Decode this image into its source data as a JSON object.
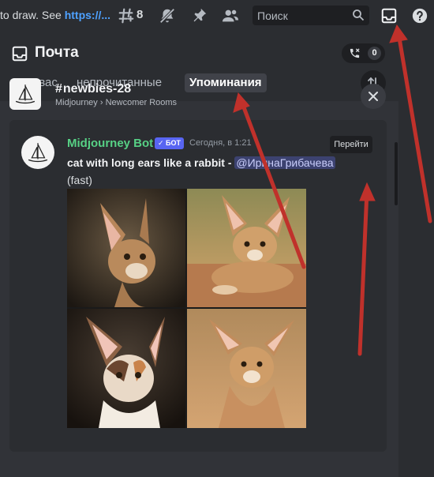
{
  "topbar": {
    "topic_text": "to draw. See ",
    "topic_link": "https://...",
    "threads_count": "8",
    "search_placeholder": "Поиск",
    "icons": [
      "threads-icon",
      "mute-icon",
      "pin-icon",
      "members-icon",
      "search-icon",
      "inbox-icon",
      "help-icon"
    ]
  },
  "inbox": {
    "title": "Почта",
    "missed_calls_count": "0",
    "tabs": [
      {
        "label": "Для вас",
        "active": false
      },
      {
        "label": "непрочитанные",
        "active": false
      },
      {
        "label": "Упоминания",
        "active": true
      }
    ]
  },
  "channel": {
    "name": "newbies-28",
    "path": "Midjourney › Newcomer Rooms"
  },
  "message": {
    "author": "Midjourney Bot",
    "bot_badge": "✓ БОТ",
    "timestamp": "Сегодня, в 1:21",
    "jump_label": "Перейти",
    "prompt": "cat with long ears like a rabbit - ",
    "mention": "@ИринаГрибачева",
    "mode": "(fast)",
    "image_alt": "four generated images of caracal-like cats"
  },
  "colors": {
    "author": "#57d185",
    "bot_badge": "#5865f2",
    "link": "#4ea1ff",
    "annotation": "#c0312b"
  }
}
